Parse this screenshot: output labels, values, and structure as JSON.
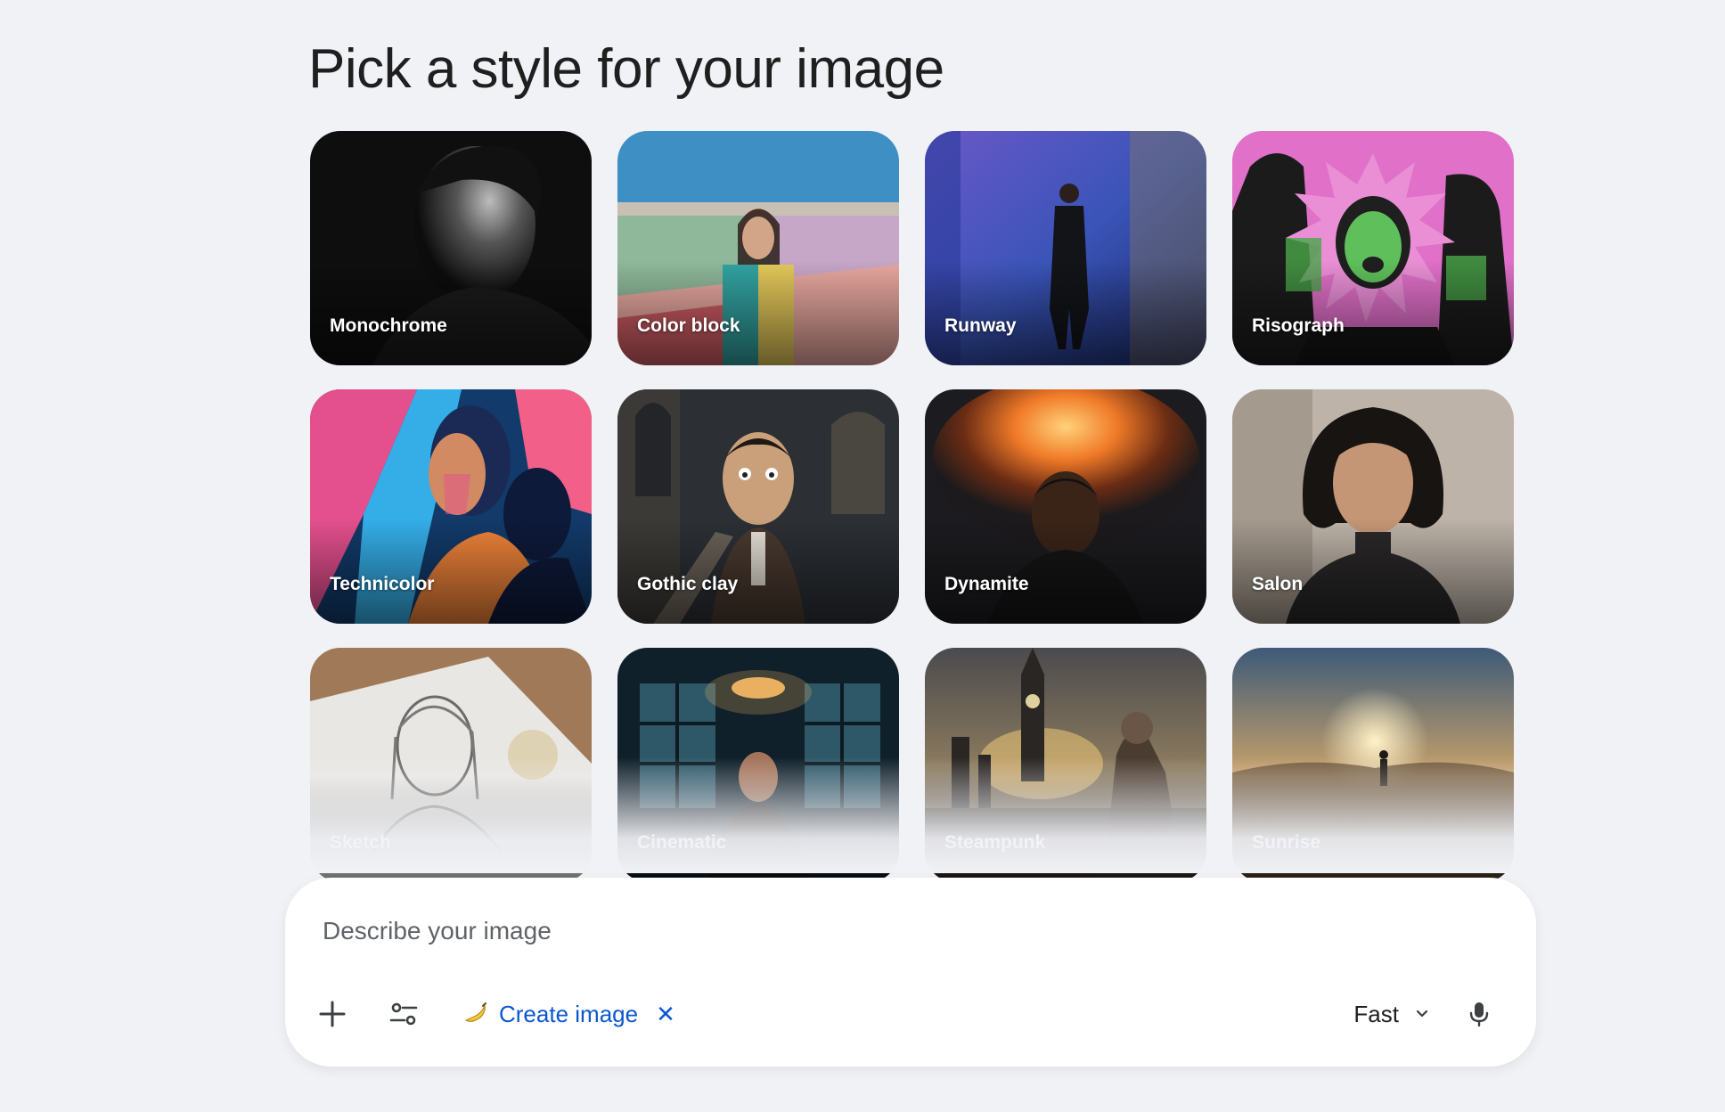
{
  "heading": "Pick a style for your image",
  "styles": [
    {
      "label": "Monochrome"
    },
    {
      "label": "Color block"
    },
    {
      "label": "Runway"
    },
    {
      "label": "Risograph"
    },
    {
      "label": "Technicolor"
    },
    {
      "label": "Gothic clay"
    },
    {
      "label": "Dynamite"
    },
    {
      "label": "Salon"
    },
    {
      "label": "Sketch"
    },
    {
      "label": "Cinematic"
    },
    {
      "label": "Steampunk"
    },
    {
      "label": "Sunrise"
    }
  ],
  "composer": {
    "placeholder": "Describe your image",
    "value": "",
    "tool_chip": {
      "label": "Create image",
      "icon": "banana-icon",
      "remove_icon": "close-icon"
    },
    "model_selector": {
      "value": "Fast",
      "icon": "chevron-down-icon"
    },
    "icons": {
      "add": "plus-icon",
      "tools": "tune-icon",
      "voice": "mic-icon"
    }
  },
  "colors": {
    "background": "#f1f2f6",
    "accent": "#0b57d0",
    "text": "#1f1f1f"
  }
}
